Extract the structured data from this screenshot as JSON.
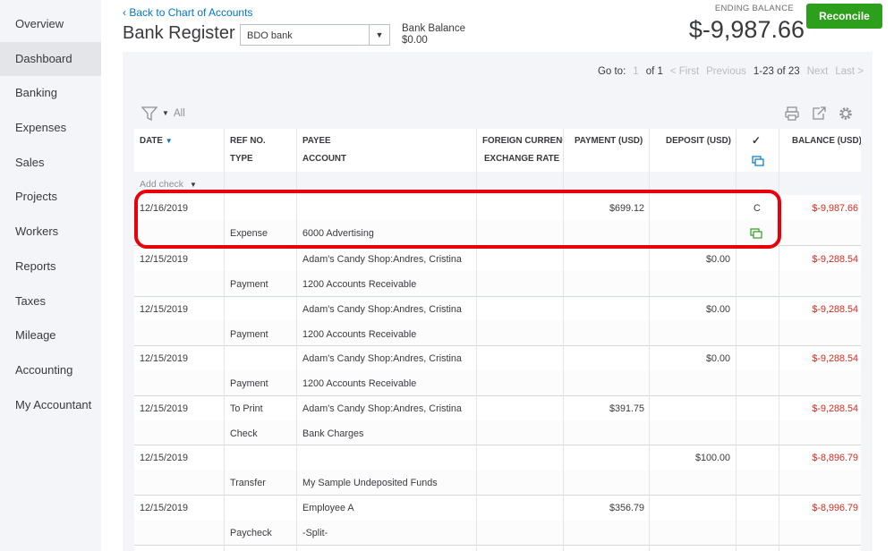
{
  "sidebar": {
    "items": [
      {
        "label": "Overview",
        "active": false
      },
      {
        "label": "Dashboard",
        "active": true
      },
      {
        "label": "Banking",
        "active": false
      },
      {
        "label": "Expenses",
        "active": false
      },
      {
        "label": "Sales",
        "active": false
      },
      {
        "label": "Projects",
        "active": false
      },
      {
        "label": "Workers",
        "active": false
      },
      {
        "label": "Reports",
        "active": false
      },
      {
        "label": "Taxes",
        "active": false
      },
      {
        "label": "Mileage",
        "active": false
      },
      {
        "label": "Accounting",
        "active": false
      },
      {
        "label": "My Accountant",
        "active": false
      }
    ]
  },
  "header": {
    "back_link": "Back to Chart of Accounts",
    "title": "Bank Register",
    "account_select": "BDO bank",
    "bank_balance_label": "Bank Balance",
    "bank_balance_value": "$0.00",
    "ending_balance_label": "ENDING BALANCE",
    "ending_balance_value": "$-9,987.66",
    "reconcile_label": "Reconcile"
  },
  "pager": {
    "goto_label": "Go to:",
    "page": "1",
    "of": "of 1",
    "first": "< First",
    "previous": "Previous",
    "range": "1-23 of 23",
    "next": "Next",
    "last": "Last >"
  },
  "toolbar": {
    "filter_label": "All"
  },
  "columns": {
    "date": "DATE",
    "ref_no": "REF NO.",
    "type": "TYPE",
    "payee": "PAYEE",
    "account": "ACCOUNT",
    "foreign_currency": "FOREIGN CURRENCY",
    "exchange_rate": "EXCHANGE RATE",
    "payment": "PAYMENT (USD)",
    "deposit": "DEPOSIT (USD)",
    "reconcile_mark": "✓",
    "balance": "BALANCE (USD)"
  },
  "add_check_label": "Add check",
  "rows": [
    {
      "date": "12/16/2019",
      "ref": "",
      "type": "Expense",
      "payee": "",
      "account": "6000 Advertising",
      "payment": "$699.12",
      "deposit": "",
      "status": "C",
      "balance": "$-9,987.66"
    },
    {
      "date": "12/15/2019",
      "ref": "",
      "type": "Payment",
      "payee": "Adam's Candy Shop:Andres, Cristina",
      "account": "1200 Accounts Receivable",
      "payment": "",
      "deposit": "$0.00",
      "status": "",
      "balance": "$-9,288.54"
    },
    {
      "date": "12/15/2019",
      "ref": "",
      "type": "Payment",
      "payee": "Adam's Candy Shop:Andres, Cristina",
      "account": "1200 Accounts Receivable",
      "payment": "",
      "deposit": "$0.00",
      "status": "",
      "balance": "$-9,288.54"
    },
    {
      "date": "12/15/2019",
      "ref": "",
      "type": "Payment",
      "payee": "Adam's Candy Shop:Andres, Cristina",
      "account": "1200 Accounts Receivable",
      "payment": "",
      "deposit": "$0.00",
      "status": "",
      "balance": "$-9,288.54"
    },
    {
      "date": "12/15/2019",
      "ref": "To Print",
      "type": "Check",
      "payee": "Adam's Candy Shop:Andres, Cristina",
      "account": "Bank Charges",
      "payment": "$391.75",
      "deposit": "",
      "status": "",
      "balance": "$-9,288.54"
    },
    {
      "date": "12/15/2019",
      "ref": "",
      "type": "Transfer",
      "payee": "",
      "account": "My Sample Undeposited Funds",
      "payment": "",
      "deposit": "$100.00",
      "status": "",
      "balance": "$-8,896.79"
    },
    {
      "date": "12/15/2019",
      "ref": "",
      "type": "Paycheck",
      "payee": "Employee A",
      "account": "-Split-",
      "payment": "$356.79",
      "deposit": "",
      "status": "",
      "balance": "$-8,996.79"
    }
  ],
  "colors": {
    "accent": "#0077c5",
    "reconcile": "#2ca01c",
    "negative": "#d52b1e",
    "highlight": "#e8000b"
  }
}
